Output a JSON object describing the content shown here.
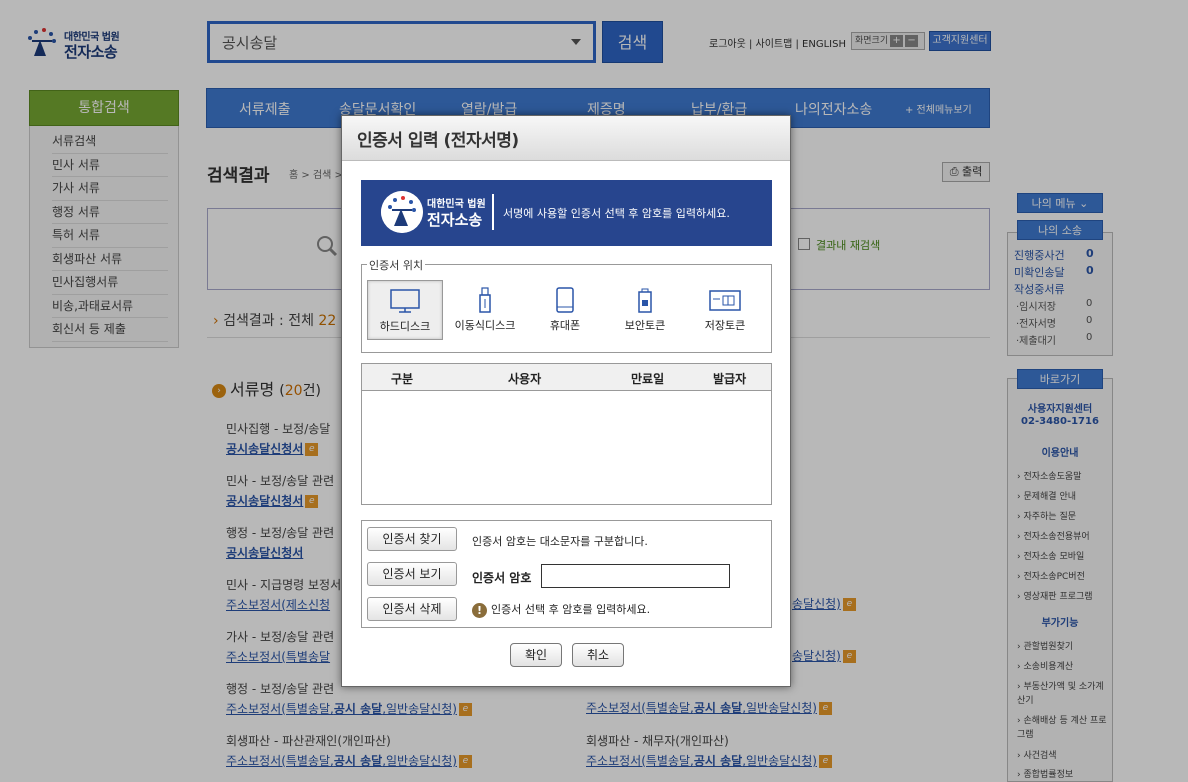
{
  "header": {
    "logo_line1": "대한민국 법원",
    "logo_line2": "전자소송",
    "search_value": "공시송달",
    "search_button": "검색",
    "top_links": "로그아웃 | 사이트맵 | ENGLISH",
    "size_label": "화면크기",
    "size_plus": "+",
    "size_minus": "−",
    "help_button": "고객지원센터"
  },
  "left_nav": {
    "heading": "통합검색",
    "items": [
      "서류검색",
      "민사 서류",
      "가사 서류",
      "행정 서류",
      "특허 서류",
      "회생파산 서류",
      "민사집행서류",
      "비송,과태료서류",
      "회신서 등 제출"
    ]
  },
  "main_menu": {
    "items": [
      "서류제출",
      "송달문서확인",
      "열람/발급",
      "제증명",
      "납부/환급",
      "나의전자소송"
    ],
    "all_menu": "+ 전체메뉴보기"
  },
  "content": {
    "title": "검색결과",
    "breadcrumb": "홈 > 검색 >",
    "print_button": "출력",
    "research_label": "결과내 재검색",
    "result_prefix": "검색결과 : 전체 ",
    "result_count": "22",
    "section_title": "서류명",
    "section_count_pre": "(",
    "section_count": "20",
    "section_count_post": "건)",
    "results_left": [
      {
        "title": "민사집행 - 보정/송달",
        "link": "공시송달신청서"
      },
      {
        "title": "민사 - 보정/송달 관련",
        "link": "공시송달신청서"
      },
      {
        "title": "행정 - 보정/송달 관련",
        "link": "공시송달신청서"
      },
      {
        "title": "민사 - 지급명령 보정서",
        "link": "주소보정서(제소신청"
      },
      {
        "title": "가사 - 보정/송달 관련",
        "link": "주소보정서(특별송달"
      },
      {
        "title": "행정 - 보정/송달 관련",
        "link_a": "주소보정서(특별송달,",
        "link_b": "공시 송달",
        "link_c": ",일반송달신청)"
      },
      {
        "title": "회생파산 - 파산관재인(개인파산)",
        "link_a": "주소보정서(특별송달,",
        "link_b": "공시 송달",
        "link_c": ",일반송달신청)"
      }
    ],
    "results_right": [
      {
        "title": "",
        "link": "송달신청)"
      },
      {
        "title": "",
        "link": "송달신청)"
      },
      {
        "link_a": "주소보정서(특별송달,",
        "link_b": "공시 송달",
        "link_c": ",일반송달신청)"
      },
      {
        "title": "회생파산 - 채무자(개인파산)",
        "link_a": "주소보정서(특별송달,",
        "link_b": "공시 송달",
        "link_c": ",일반송달신청)"
      }
    ]
  },
  "right_sidebar": {
    "my_menu": "나의 메뉴 ⌄",
    "my_case": "나의 소송",
    "case_rows": [
      {
        "label": "진행중사건",
        "count": "0"
      },
      {
        "label": "미확인송달",
        "count": "0"
      },
      {
        "label": "작성중서류",
        "count": ""
      }
    ],
    "case_subrows": [
      {
        "label": "·임시저장",
        "count": "0"
      },
      {
        "label": "·전자서명",
        "count": "0"
      },
      {
        "label": "·제출대기",
        "count": "0"
      }
    ],
    "shortcuts": "바로가기",
    "support_center": "사용자지원센터",
    "support_phone": "02-3480-1716",
    "usage_guide": "이용안내",
    "guide_links": [
      "전자소송도움말",
      "문제해결 안내",
      "자주하는 질문",
      "전자소송전용뷰어",
      "전자소송 모바일",
      "전자소송PC버전",
      "영상재판 프로그램"
    ],
    "extra": "부가기능",
    "extra_links": [
      "관할법원찾기",
      "소송비용계산",
      "부동산가액 및 소가계산기",
      "손해배상 등 계산 프로그램",
      "사건검색",
      "종합법률정보"
    ]
  },
  "dialog": {
    "title": "인증서 입력 (전자서명)",
    "banner_line1": "대한민국 법원",
    "banner_line2": "전자소송",
    "banner_message": "서명에 사용할 인증서 선택 후 암호를 입력하세요.",
    "location_legend": "인증서 위치",
    "locations": [
      "하드디스크",
      "이동식디스크",
      "휴대폰",
      "보안토큰",
      "저장토큰"
    ],
    "table_headers": [
      "구분",
      "사용자",
      "만료일",
      "발급자"
    ],
    "find_button": "인증서 찾기",
    "find_note": "인증서 암호는 대소문자를 구분합니다.",
    "view_button": "인증서 보기",
    "password_label": "인증서 암호",
    "password_value": "",
    "delete_button": "인증서 삭제",
    "warning_text": "인증서 선택 후 암호를 입력하세요.",
    "ok_button": "확인",
    "cancel_button": "취소"
  },
  "colors": {
    "primary_blue": "#3f7ad2",
    "nav_green": "#77a832",
    "banner_navy": "#27458e",
    "accent_orange": "#d07000"
  }
}
